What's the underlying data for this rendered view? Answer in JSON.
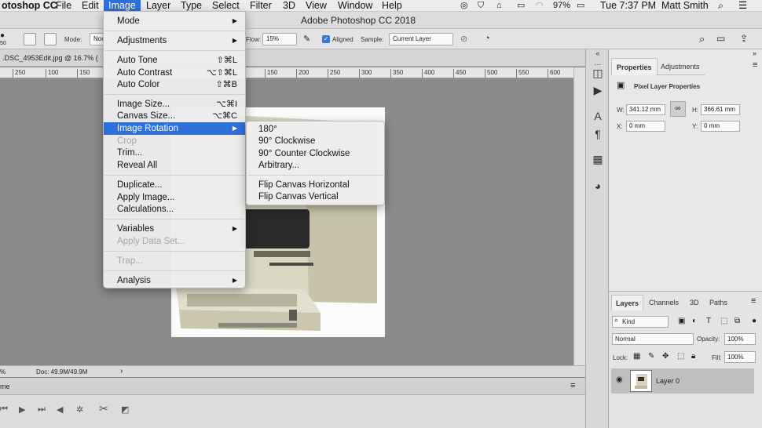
{
  "menubar": {
    "app_name": "otoshop CC",
    "items": [
      "File",
      "Edit",
      "Image",
      "Layer",
      "Type",
      "Select",
      "Filter",
      "3D",
      "View",
      "Window",
      "Help"
    ],
    "battery": "97%",
    "clock": "Tue 7:37 PM",
    "user": "Matt Smith"
  },
  "title": "Adobe Photoshop CC 2018",
  "options": {
    "mode_label": "Mode:",
    "mode_value": "Nor",
    "flow_label": "Flow:",
    "flow_value": "15%",
    "aligned_label": "Aligned",
    "sample_label": "Sample:",
    "sample_value": "Current Layer",
    "brush_size": "50"
  },
  "document": {
    "tab_label": ".DSC_4953Edit.jpg @ 16.7% (",
    "doc_size": "Doc: 49.9M/49.9M",
    "zoom_fragment": "%",
    "ruler_ticks": [
      "250",
      "100",
      "150",
      "150",
      "200",
      "250",
      "300",
      "350",
      "400",
      "450",
      "500",
      "550",
      "600"
    ]
  },
  "image_menu": {
    "items": [
      {
        "label": "Mode",
        "submenu": true
      },
      {
        "label": "Adjustments",
        "submenu": true
      },
      {
        "label": "Auto Tone",
        "shortcut": "⇧⌘L"
      },
      {
        "label": "Auto Contrast",
        "shortcut": "⌥⇧⌘L"
      },
      {
        "label": "Auto Color",
        "shortcut": "⇧⌘B"
      },
      {
        "label": "Image Size...",
        "shortcut": "⌥⌘I"
      },
      {
        "label": "Canvas Size...",
        "shortcut": "⌥⌘C"
      },
      {
        "label": "Image Rotation",
        "submenu": true,
        "highlighted": true
      },
      {
        "label": "Crop",
        "disabled": true
      },
      {
        "label": "Trim..."
      },
      {
        "label": "Reveal All"
      },
      {
        "label": "Duplicate..."
      },
      {
        "label": "Apply Image..."
      },
      {
        "label": "Calculations..."
      },
      {
        "label": "Variables",
        "submenu": true
      },
      {
        "label": "Apply Data Set...",
        "disabled": true
      },
      {
        "label": "Trap...",
        "disabled": true
      },
      {
        "label": "Analysis",
        "submenu": true
      }
    ]
  },
  "rotation_submenu": {
    "items": [
      "180°",
      "90° Clockwise",
      "90° Counter Clockwise",
      "Arbitrary...",
      "Flip Canvas Horizontal",
      "Flip Canvas Vertical"
    ]
  },
  "properties": {
    "tab_properties": "Properties",
    "tab_adjustments": "Adjustments",
    "section_title": "Pixel Layer Properties",
    "w_label": "W:",
    "w_value": "341.12 mm",
    "h_label": "H:",
    "h_value": "366.61 mm",
    "x_label": "X:",
    "x_value": "0 mm",
    "y_label": "Y:",
    "y_value": "0 mm"
  },
  "layers": {
    "tabs": [
      "Layers",
      "Channels",
      "3D",
      "Paths"
    ],
    "filter_kind": "Kind",
    "blend_mode": "Normal",
    "opacity_label": "Opacity:",
    "opacity_value": "100%",
    "lock_label": "Lock:",
    "fill_label": "Fill:",
    "fill_value": "100%",
    "layer_name": "Layer 0"
  },
  "timeline": {
    "header": "me"
  },
  "colors": {
    "menu_highlight": "#2f6fd8",
    "canvas_bg": "#888888"
  }
}
